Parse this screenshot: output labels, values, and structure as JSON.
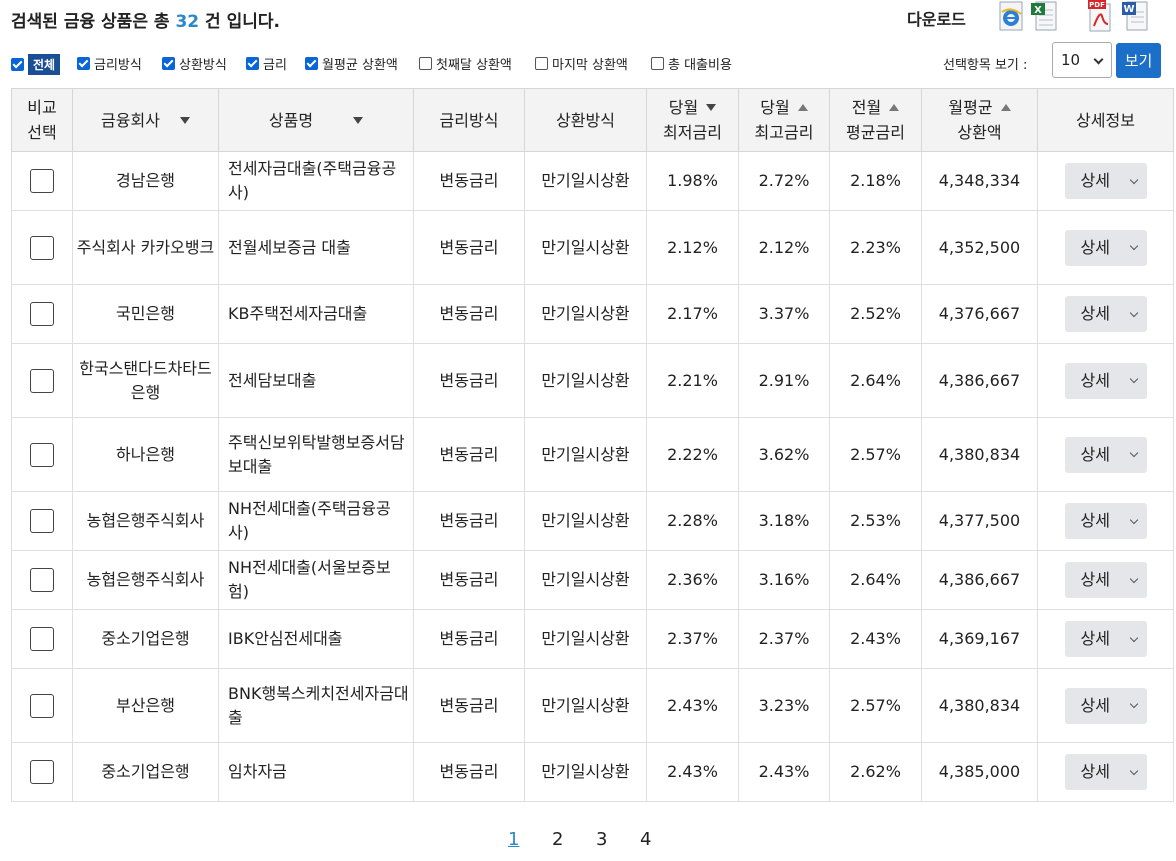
{
  "summary": {
    "prefix": "검색된 금융 상품은 총 ",
    "count": "32",
    "suffix": " 건 입니다."
  },
  "download": {
    "label": "다운로드",
    "icons": [
      "ie-icon",
      "excel-icon",
      "pdf-icon",
      "word-icon"
    ]
  },
  "filters": {
    "all_label": "전체",
    "items": [
      {
        "label": "금리방식",
        "checked": true
      },
      {
        "label": "상환방식",
        "checked": true
      },
      {
        "label": "금리",
        "checked": true
      },
      {
        "label": "월평균 상환액",
        "checked": true
      },
      {
        "label": "첫째달 상환액",
        "checked": false
      },
      {
        "label": "마지막 상환액",
        "checked": false
      },
      {
        "label": "총 대출비용",
        "checked": false
      }
    ],
    "view_label": "선택항목 보기 :",
    "page_size": "10",
    "view_button": "보기"
  },
  "table": {
    "headers": {
      "compare_1": "비교",
      "compare_2": "선택",
      "company": "금융회사",
      "product": "상품명",
      "rate_type": "금리방식",
      "repay_type": "상환방식",
      "min_rate_1": "당월",
      "min_rate_2": "최저금리",
      "max_rate_1": "당월",
      "max_rate_2": "최고금리",
      "avg_rate_1": "전월",
      "avg_rate_2": "평균금리",
      "monthly_1": "월평균",
      "monthly_2": "상환액",
      "detail": "상세정보"
    },
    "rows": [
      {
        "company": "경남은행",
        "product": "전세자금대출(주택금융공사)",
        "rate_type": "변동금리",
        "repay_type": "만기일시상환",
        "min_rate": "1.98%",
        "max_rate": "2.72%",
        "avg_rate": "2.18%",
        "monthly": "4,348,334",
        "detail": "상세"
      },
      {
        "company": "주식회사 카카오뱅크",
        "product": "전월세보증금 대출",
        "rate_type": "변동금리",
        "repay_type": "만기일시상환",
        "min_rate": "2.12%",
        "max_rate": "2.12%",
        "avg_rate": "2.23%",
        "monthly": "4,352,500",
        "detail": "상세"
      },
      {
        "company": "국민은행",
        "product": "KB주택전세자금대출",
        "rate_type": "변동금리",
        "repay_type": "만기일시상환",
        "min_rate": "2.17%",
        "max_rate": "3.37%",
        "avg_rate": "2.52%",
        "monthly": "4,376,667",
        "detail": "상세"
      },
      {
        "company": "한국스탠다드차타드은행",
        "product": "전세담보대출",
        "rate_type": "변동금리",
        "repay_type": "만기일시상환",
        "min_rate": "2.21%",
        "max_rate": "2.91%",
        "avg_rate": "2.64%",
        "monthly": "4,386,667",
        "detail": "상세"
      },
      {
        "company": "하나은행",
        "product": "주택신보위탁발행보증서담보대출",
        "rate_type": "변동금리",
        "repay_type": "만기일시상환",
        "min_rate": "2.22%",
        "max_rate": "3.62%",
        "avg_rate": "2.57%",
        "monthly": "4,380,834",
        "detail": "상세"
      },
      {
        "company": "농협은행주식회사",
        "product": "NH전세대출(주택금융공사)",
        "rate_type": "변동금리",
        "repay_type": "만기일시상환",
        "min_rate": "2.28%",
        "max_rate": "3.18%",
        "avg_rate": "2.53%",
        "monthly": "4,377,500",
        "detail": "상세"
      },
      {
        "company": "농협은행주식회사",
        "product": "NH전세대출(서울보증보험)",
        "rate_type": "변동금리",
        "repay_type": "만기일시상환",
        "min_rate": "2.36%",
        "max_rate": "3.16%",
        "avg_rate": "2.64%",
        "monthly": "4,386,667",
        "detail": "상세"
      },
      {
        "company": "중소기업은행",
        "product": "IBK안심전세대출",
        "rate_type": "변동금리",
        "repay_type": "만기일시상환",
        "min_rate": "2.37%",
        "max_rate": "2.37%",
        "avg_rate": "2.43%",
        "monthly": "4,369,167",
        "detail": "상세"
      },
      {
        "company": "부산은행",
        "product": "BNK행복스케치전세자금대출",
        "rate_type": "변동금리",
        "repay_type": "만기일시상환",
        "min_rate": "2.43%",
        "max_rate": "3.23%",
        "avg_rate": "2.57%",
        "monthly": "4,380,834",
        "detail": "상세"
      },
      {
        "company": "중소기업은행",
        "product": "임차자금",
        "rate_type": "변동금리",
        "repay_type": "만기일시상환",
        "min_rate": "2.43%",
        "max_rate": "2.43%",
        "avg_rate": "2.62%",
        "monthly": "4,385,000",
        "detail": "상세"
      }
    ]
  },
  "pagination": {
    "pages": [
      "1",
      "2",
      "3",
      "4"
    ],
    "current": "1"
  }
}
